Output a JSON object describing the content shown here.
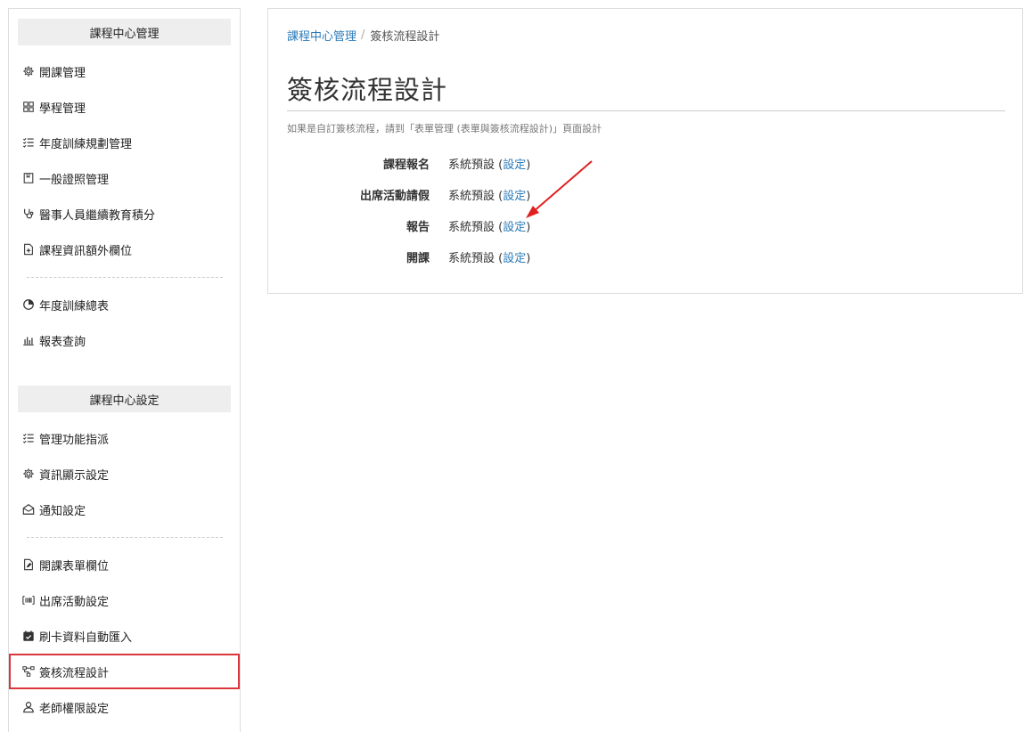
{
  "sidebar": {
    "section1": {
      "title": "課程中心管理",
      "items": [
        {
          "label": "開課管理",
          "icon": "gear-icon"
        },
        {
          "label": "學程管理",
          "icon": "grid-icon"
        },
        {
          "label": "年度訓練規劃管理",
          "icon": "checklist-icon"
        },
        {
          "label": "一般證照管理",
          "icon": "certificate-icon"
        },
        {
          "label": "醫事人員繼續教育積分",
          "icon": "stethoscope-icon"
        },
        {
          "label": "課程資訊額外欄位",
          "icon": "file-plus-icon"
        }
      ],
      "items2": [
        {
          "label": "年度訓練總表",
          "icon": "pie-chart-icon"
        },
        {
          "label": "報表查詢",
          "icon": "bar-chart-icon"
        }
      ]
    },
    "section2": {
      "title": "課程中心設定",
      "items": [
        {
          "label": "管理功能指派",
          "icon": "checklist-icon"
        },
        {
          "label": "資訊顯示設定",
          "icon": "gear-icon"
        },
        {
          "label": "通知設定",
          "icon": "envelope-open-icon"
        }
      ],
      "items2": [
        {
          "label": "開課表單欄位",
          "icon": "file-edit-icon"
        },
        {
          "label": "出席活動設定",
          "icon": "barcode-icon"
        },
        {
          "label": "刷卡資料自動匯入",
          "icon": "calendar-check-icon"
        },
        {
          "label": "簽核流程設計",
          "icon": "flowchart-icon"
        },
        {
          "label": "老師權限設定",
          "icon": "user-icon"
        }
      ]
    }
  },
  "breadcrumb": {
    "parent": "課程中心管理",
    "separator": "/",
    "current": "簽核流程設計"
  },
  "page": {
    "title": "簽核流程設計",
    "help_text": "如果是自訂簽核流程，請到「表單管理 (表單與簽核流程設計)」頁面設計"
  },
  "flows": [
    {
      "label": "課程報名",
      "value": "系統預設",
      "open": "(",
      "link": "設定",
      "close": ")"
    },
    {
      "label": "出席活動請假",
      "value": "系統預設",
      "open": "(",
      "link": "設定",
      "close": ")"
    },
    {
      "label": "報告",
      "value": "系統預設",
      "open": "(",
      "link": "設定",
      "close": ")"
    },
    {
      "label": "開課",
      "value": "系統預設",
      "open": "(",
      "link": "設定",
      "close": ")"
    }
  ],
  "colors": {
    "link": "#2b7bb9",
    "highlight": "#d9363e",
    "arrow": "#e02020"
  }
}
